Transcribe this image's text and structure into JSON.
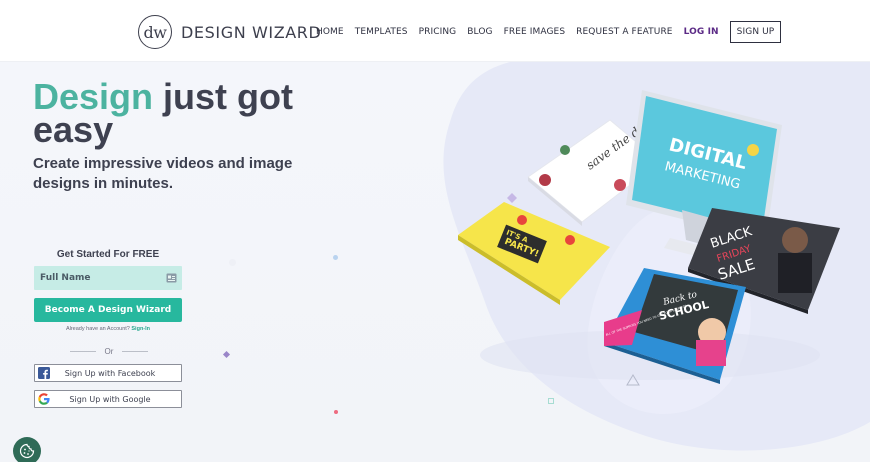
{
  "header": {
    "logo_monogram": "dw",
    "logo_text": "DESIGN WIZARD",
    "nav": {
      "home": "HOME",
      "templates": "TEMPLATES",
      "pricing": "PRICING",
      "blog": "BLOG",
      "free_images": "FREE IMAGES",
      "request_feature": "REQUEST A FEATURE",
      "login": "LOG IN",
      "signup": "SIGN UP"
    }
  },
  "hero": {
    "headline_accent": "Design",
    "headline_rest": " just got easy",
    "subhead": "Create impressive videos and image designs in minutes."
  },
  "form": {
    "title": "Get Started For FREE",
    "name_placeholder": "Full Name",
    "primary_button": "Become A Design Wizard",
    "already_text": "Already have an Account?",
    "signin_link": "Sign-In",
    "or_text": "Or",
    "facebook_button": "Sign Up with Facebook",
    "google_button": "Sign Up with Google"
  },
  "illustration": {
    "monitor_line1": "DIGITAL",
    "monitor_line2": "MARKETING",
    "save_card": "save the date",
    "party_line1": "IT'S A",
    "party_line2": "PARTY!",
    "black_friday_line1": "BLACK",
    "black_friday_line2": "FRIDAY",
    "black_friday_line3": "SALE",
    "school_line1": "Back to",
    "school_line2": "SCHOOL",
    "school_promo": "ALL OF THE SUPPLIES YOU NEED TO GET YOUR STARTED!"
  },
  "icons": {
    "card": "id-card-icon",
    "facebook": "facebook-icon",
    "google": "google-icon",
    "cookie": "cookie-icon"
  },
  "colors": {
    "accent": "#4cb3a0",
    "primary_button": "#27b89e",
    "login": "#5b2a86",
    "input_bg": "#c6ece6",
    "cookie_bg": "#2f6b57"
  }
}
